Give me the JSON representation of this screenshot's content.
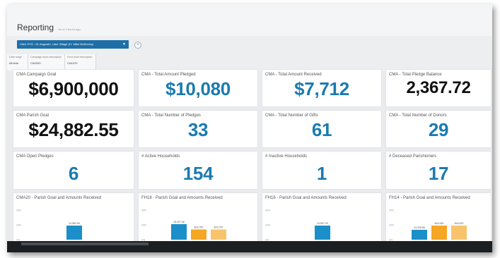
{
  "header": {
    "title": "Reporting",
    "subtitle": "As of 4 hours ago"
  },
  "filters": {
    "active_chip": "CMA 7070 - St. Augustin, Lake Village (Fr. Mike McKinney)",
    "add_icon": "plus-circle-icon",
    "columns": [
      {
        "label": "Date range",
        "value": "All time"
      },
      {
        "label": "Campaign short description",
        "value": "CA2020"
      },
      {
        "label": "Fund short description",
        "value": "CA1070"
      }
    ]
  },
  "kpis": {
    "campaign_goal": {
      "label": "CMA Campaign Goal",
      "value": "$6,900,000"
    },
    "total_pledged": {
      "label": "CMA - Total Amount Pledged",
      "value": "$10,080"
    },
    "total_received": {
      "label": "CMA - Total Amount Received",
      "value": "$7,712"
    },
    "pledge_balance": {
      "label": "CMA - Total Pledge Balance",
      "value": "2,367.72"
    },
    "parish_goal": {
      "label": "CMA Parish Goal",
      "value": "$24,882.55"
    },
    "num_pledges": {
      "label": "CMA - Total Number of Pledges",
      "value": "33"
    },
    "num_gifts": {
      "label": "CMA - Total Number of Gifts",
      "value": "61"
    },
    "num_donors": {
      "label": "CMA - Total Number of Donors",
      "value": "29"
    },
    "open_pledges": {
      "label": "CMA Open Pledges",
      "value": "6"
    },
    "active_households": {
      "label": "# Active Households",
      "value": "154"
    },
    "inactive_households": {
      "label": "# Inactive Households",
      "value": "1"
    },
    "deceased": {
      "label": "# Deceased Parishioners",
      "value": "17"
    }
  },
  "colors": {
    "accent_blue": "#1a7bb0",
    "bar_blue": "#1b8fc9",
    "bar_orange": "#f5a623",
    "bar_light_orange": "#f7c46c"
  },
  "chart_data": [
    {
      "type": "bar",
      "title": "CMA20 - Parish Goal and Amounts Received",
      "y_tick_labels": [
        "40%",
        "20%",
        "0%"
      ],
      "bars": [
        {
          "data_label": "24,882.55",
          "value": 24882.55,
          "color": "#1b8fc9"
        }
      ]
    },
    {
      "type": "bar",
      "title": "FH18 - Parish Goal and Amounts Received",
      "y_tick_labels": [
        "40%",
        "20%",
        "0%"
      ],
      "bars": [
        {
          "data_label": "25,497.96",
          "value": 25497.96,
          "color": "#1b8fc9"
        },
        {
          "data_label": "$16,750",
          "value": 16750,
          "color": "#f5a623"
        },
        {
          "data_label": "$16,750",
          "value": 16750,
          "color": "#f7c46c"
        }
      ]
    },
    {
      "type": "bar",
      "title": "FH16 - Parish Goal and Amounts Received",
      "y_tick_labels": [
        "40%",
        "20%",
        "0%"
      ],
      "bars": [
        {
          "data_label": "24,857.00",
          "value": 24857.0,
          "color": "#1b8fc9"
        }
      ]
    },
    {
      "type": "bar",
      "title": "FH14 - Parish Goal and Amounts Received",
      "y_tick_labels": [
        "40%",
        "20%",
        "0%"
      ],
      "bars": [
        {
          "data_label": "24,005.86",
          "value": 24005.86,
          "color": "#1b8fc9"
        },
        {
          "data_label": "$44,526",
          "value": 44526,
          "color": "#f5a623"
        },
        {
          "data_label": "$44,525",
          "value": 44525,
          "color": "#f7c46c"
        }
      ]
    }
  ]
}
